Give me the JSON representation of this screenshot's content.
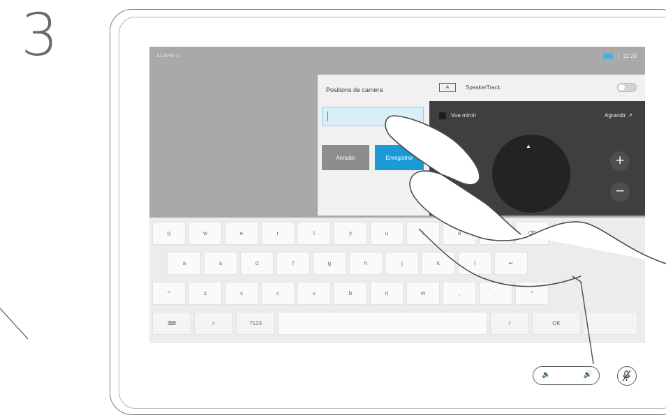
{
  "step": {
    "number": "3"
  },
  "status_bar": {
    "left_label": "ACSPG 0",
    "separator": "|",
    "time": "11:29"
  },
  "positions_panel": {
    "title": "Positions de caméra",
    "input": {
      "value": ""
    },
    "cancel_label": "Annuler",
    "save_label": "Enregistrer"
  },
  "speaker_panel": {
    "icon_label": "A",
    "label": "SpeakerTrack",
    "self_view_label": "Vue miroir",
    "enlarge_label": "Agrandir",
    "enlarge_icon": "↗"
  },
  "keyboard": {
    "row1": [
      "q",
      "w",
      "e",
      "r",
      "t",
      "y",
      "u",
      "i",
      "o",
      "p",
      "⌫"
    ],
    "row2": [
      "a",
      "s",
      "d",
      "f",
      "g",
      "h",
      "j",
      "k",
      "l",
      "↵"
    ],
    "row3": [
      "^",
      "z",
      "x",
      "c",
      "v",
      "b",
      "n",
      "m",
      ",",
      ".",
      "^"
    ],
    "row4": {
      "emoji": "⌨",
      "mic": "⌕",
      "num": "?123",
      "space": "",
      "slash": "/",
      "done": "OK"
    }
  },
  "controls": {
    "vol_down": "🔉",
    "vol_up": "🔊",
    "mute_icon": "🎤"
  },
  "colors": {
    "accent": "#1c9ad6",
    "panel_dark": "#2e2e2e",
    "screen_bg": "#a9a9a9"
  }
}
